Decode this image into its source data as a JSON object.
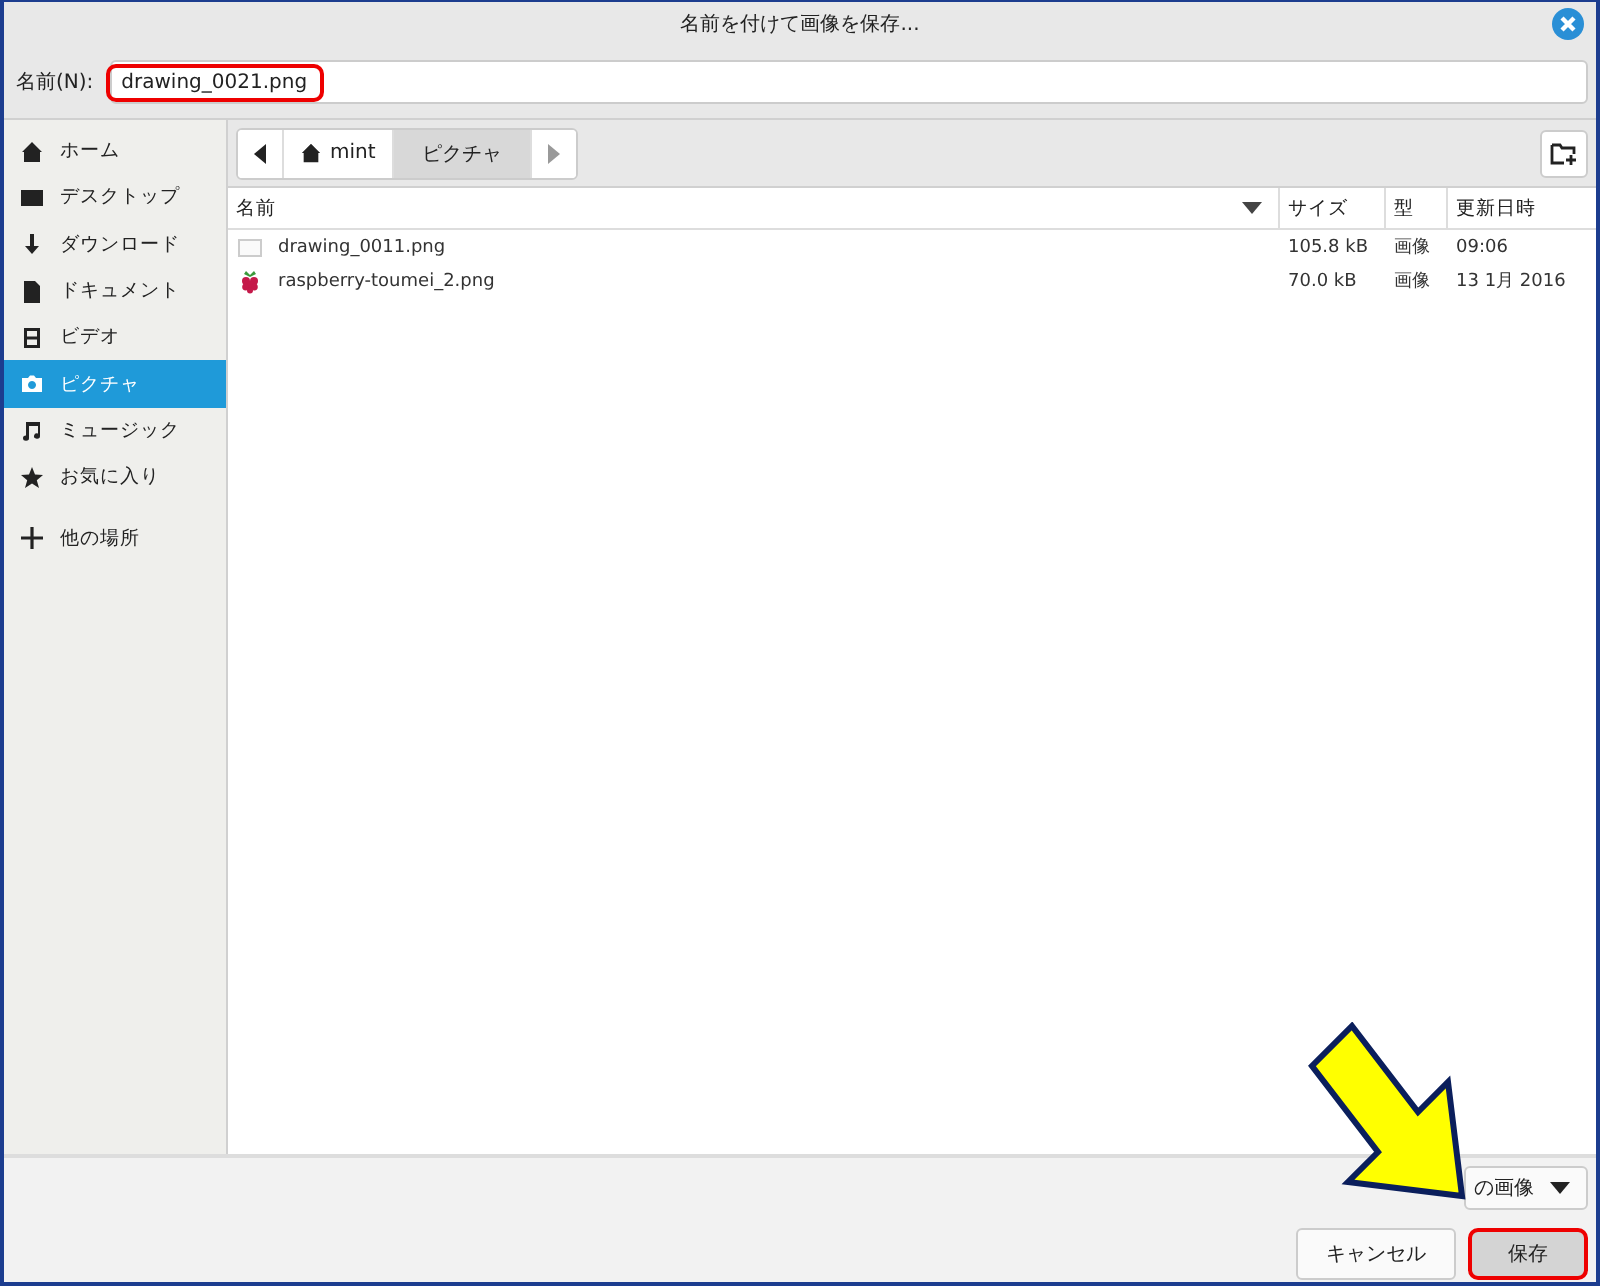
{
  "window": {
    "title": "名前を付けて画像を保存..."
  },
  "name_field": {
    "label": "名前(N):",
    "value": "drawing_0021.png",
    "highlighted": true
  },
  "path_bar": [
    {
      "label": "mint",
      "selected": false
    },
    {
      "label": "ピクチャ",
      "selected": true
    }
  ],
  "sidebar": {
    "items": [
      {
        "label": "ホーム",
        "selected": false
      },
      {
        "label": "デスクトップ",
        "selected": false
      },
      {
        "label": "ダウンロード",
        "selected": false
      },
      {
        "label": "ドキュメント",
        "selected": false
      },
      {
        "label": "ビデオ",
        "selected": false
      },
      {
        "label": "ピクチャ",
        "selected": true
      },
      {
        "label": "ミュージック",
        "selected": false
      },
      {
        "label": "お気に入り",
        "selected": false
      }
    ],
    "other": {
      "label": "他の場所",
      "selected": false
    }
  },
  "table": {
    "columns": [
      "名前",
      "サイズ",
      "型",
      "更新日時"
    ],
    "rows": [
      {
        "name": "drawing_0011.png",
        "size": "105.8 kB",
        "type": "画像",
        "modified": "09:06",
        "selected": false
      },
      {
        "name": "raspberry-toumei_2.png",
        "size": "70.0 kB",
        "type": "画像",
        "modified": "13 1月 2016",
        "selected": false
      }
    ]
  },
  "filter": {
    "label": "の画像"
  },
  "buttons": [
    {
      "label": "キャンセル",
      "highlighted": false
    },
    {
      "label": "保存",
      "highlighted": true
    }
  ]
}
